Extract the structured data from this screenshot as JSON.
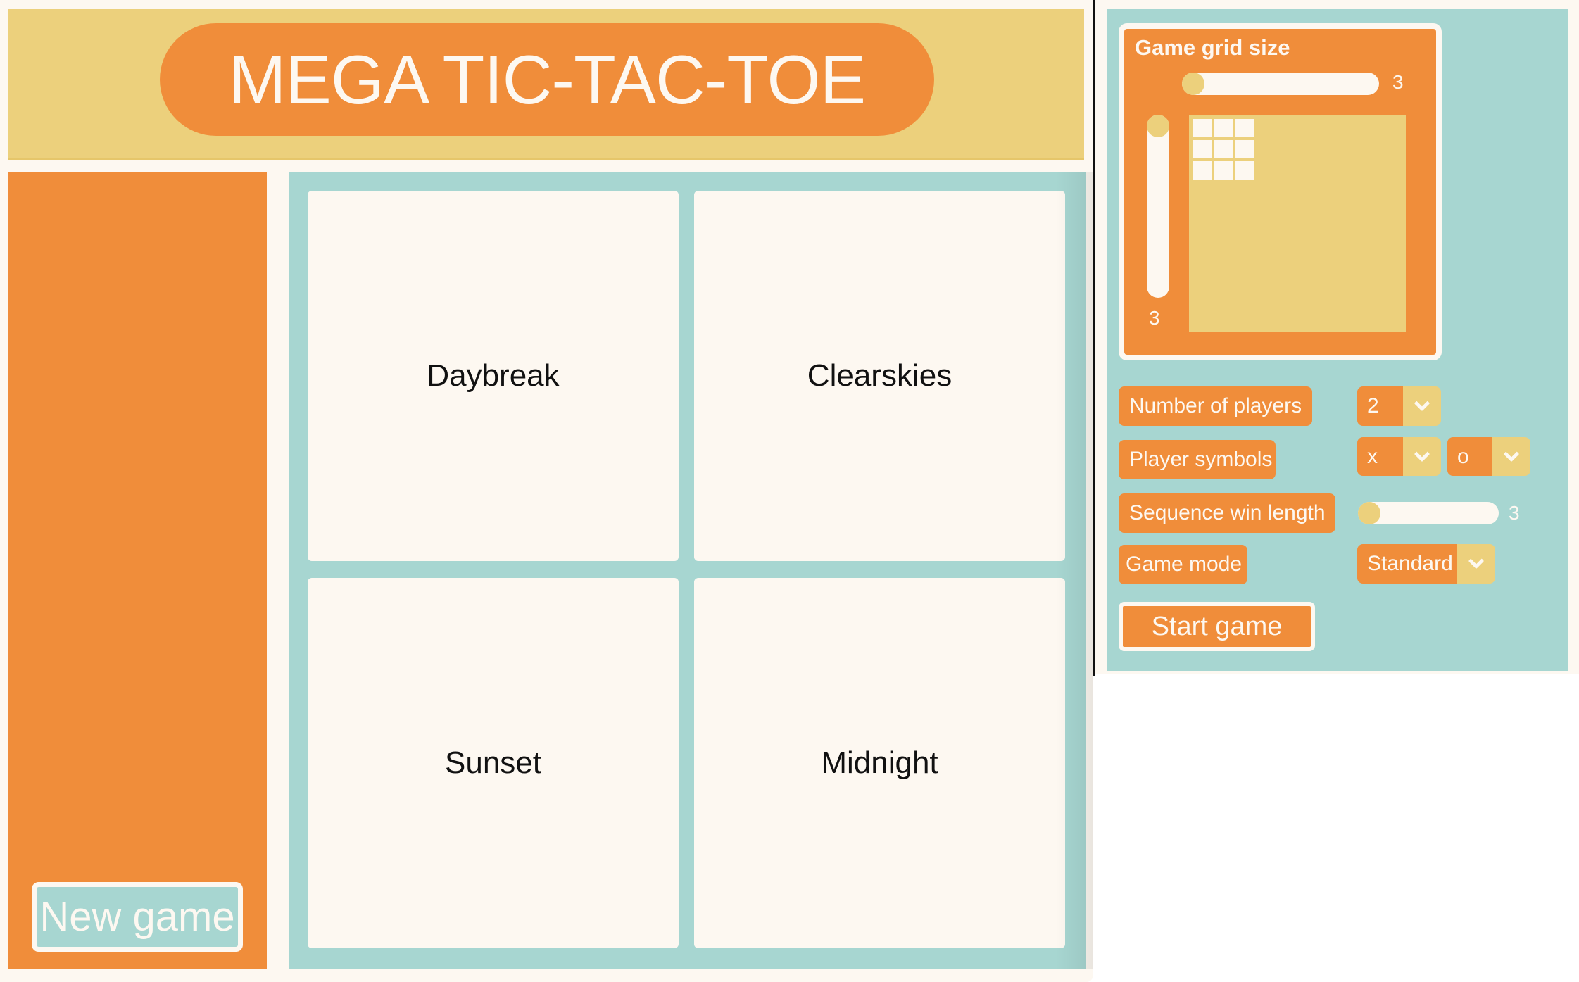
{
  "app": {
    "title": "MEGA TIC-TAC-TOE"
  },
  "sidebar": {
    "new_game_label": "New game"
  },
  "themes": [
    {
      "label": "Daybreak"
    },
    {
      "label": "Clearskies"
    },
    {
      "label": "Sunset"
    },
    {
      "label": "Midnight"
    }
  ],
  "settings": {
    "grid_size": {
      "title": "Game grid size",
      "columns": 3,
      "rows": 3,
      "columns_label": "3",
      "rows_label": "3"
    },
    "players": {
      "label": "Number of players",
      "value": "2"
    },
    "symbols": {
      "label": "Player symbols",
      "values": [
        "x",
        "o"
      ]
    },
    "sequence": {
      "label": "Sequence win length",
      "value": 3,
      "value_label": "3"
    },
    "mode": {
      "label": "Game mode",
      "value": "Standard"
    },
    "start_label": "Start game"
  },
  "colors": {
    "orange": "#f08d3a",
    "mustard": "#ecd07c",
    "teal": "#a7d6d1",
    "cream": "#fdf8f1"
  }
}
